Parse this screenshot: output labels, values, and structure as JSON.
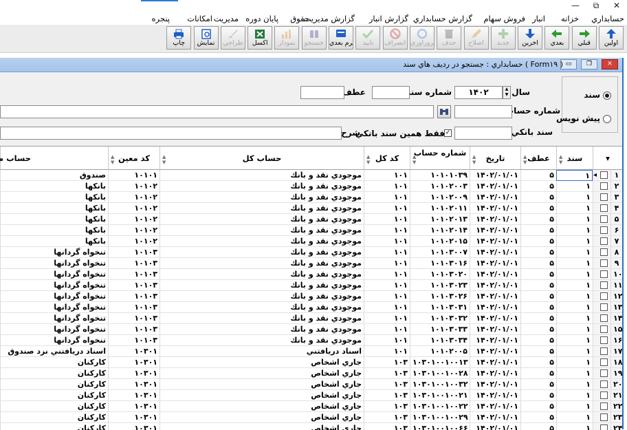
{
  "window": {
    "minimize": "—",
    "restore": "⧉",
    "close": "✕"
  },
  "menu": [
    "حسابداري",
    "خزانه",
    "انبار",
    "فروش",
    "سهام",
    "گزارش حسابداري",
    "گزارش انبار",
    "گزارش مديريت",
    "حقوق",
    "پايان دوره",
    "مديريت",
    "امكانات",
    "پنجره"
  ],
  "toolbar": [
    {
      "label": "اولين",
      "icon": "arrow-up-icon",
      "color": "#1e5fc8",
      "enabled": true
    },
    {
      "label": "قبلي",
      "icon": "arrow-right-icon",
      "color": "#2f9b2f",
      "enabled": true
    },
    {
      "label": "بعدي",
      "icon": "arrow-left-icon",
      "color": "#2f9b2f",
      "enabled": true
    },
    {
      "label": "آخرين",
      "icon": "arrow-down-icon",
      "color": "#1e5fc8",
      "enabled": true
    },
    {
      "label": "جديد",
      "icon": "plus-icon",
      "color": "#2f9b2f",
      "enabled": false
    },
    {
      "label": "اصلاح",
      "icon": "pencil-icon",
      "color": "#d08a22",
      "enabled": false
    },
    {
      "label": "حذف",
      "icon": "trash-icon",
      "color": "#555555",
      "enabled": false
    },
    {
      "label": "بروزآوري",
      "icon": "refresh-icon",
      "color": "#3a7bd5",
      "enabled": false
    },
    {
      "label": "انصراف",
      "icon": "cancel-icon",
      "color": "#c62828",
      "enabled": false
    },
    {
      "label": "تاييد",
      "icon": "check-icon",
      "color": "#2f9b2f",
      "enabled": false
    },
    {
      "label": "فرم بعدي",
      "icon": "form-icon",
      "color": "#1e5fc8",
      "enabled": true
    },
    {
      "label": "جستجو",
      "icon": "binoculars-icon",
      "color": "#3b3b8f",
      "enabled": false
    },
    {
      "label": "نمودار",
      "icon": "chart-icon",
      "color": "#e08a1e",
      "enabled": false
    },
    {
      "label": "اكسل",
      "icon": "excel-icon",
      "color": "#1f7a3a",
      "enabled": true
    },
    {
      "label": "طراحي",
      "icon": "brush-icon",
      "color": "#b04a1e",
      "enabled": false
    },
    {
      "label": "نمايش",
      "icon": "preview-icon",
      "color": "#1e5fc8",
      "enabled": true
    },
    {
      "label": "چاپ",
      "icon": "printer-icon",
      "color": "#1e5fc8",
      "enabled": true
    }
  ],
  "child_window": {
    "title": "حسابداري : جستجو در رديف هاي سند ( Form۱۹ )"
  },
  "form": {
    "radio_sanad": "سند",
    "radio_pishnevis": "پيش نويس",
    "sal_label": "سال",
    "sal_value": "۱۴۰۲",
    "shomare_sanad_label": "شماره سند",
    "shomare_sanad_value": "",
    "atf_label": "عطف",
    "atf_value": "",
    "shomare_hesab_label": "شماره حساب",
    "shomare_hesab_value": "",
    "sanad_banki_label": "سند بانكي",
    "sanad_banki_value": "",
    "faghat_label": "فقط همين سند بانكي",
    "sharh_label": "شرح",
    "sharh_value": ""
  },
  "grid": {
    "headers": {
      "sanad": "سند",
      "atf": "عطف",
      "tarikh": "تاريخ",
      "shomare_hesab": "شماره حساب",
      "kod_kol": "كد كل",
      "hesab_kol": "حساب كل",
      "kod_moein": "كد معين",
      "hesab_moein": "حساب معين"
    },
    "rows": [
      {
        "n": "۱",
        "sanad": "۱",
        "atf": "۵",
        "tarikh": "۱۴۰۲/۰۱/۰۱",
        "hesab": "۱۰۱۰۱۰۳۹",
        "kol": "۱۰۱",
        "kolname": "موجودي نقد و بانك",
        "moein": "۱۰۱۰۱",
        "moeinname": "صندوق"
      },
      {
        "n": "۲",
        "sanad": "۱",
        "atf": "۵",
        "tarikh": "۱۴۰۲/۰۱/۰۱",
        "hesab": "۱۰۱۰۲۰۰۳",
        "kol": "۱۰۱",
        "kolname": "موجودي نقد و بانك",
        "moein": "۱۰۱۰۲",
        "moeinname": "بانكها"
      },
      {
        "n": "۳",
        "sanad": "۱",
        "atf": "۵",
        "tarikh": "۱۴۰۲/۰۱/۰۱",
        "hesab": "۱۰۱۰۲۰۰۹",
        "kol": "۱۰۱",
        "kolname": "موجودي نقد و بانك",
        "moein": "۱۰۱۰۲",
        "moeinname": "بانكها"
      },
      {
        "n": "۴",
        "sanad": "۱",
        "atf": "۵",
        "tarikh": "۱۴۰۲/۰۱/۰۱",
        "hesab": "۱۰۱۰۲۰۱۱",
        "kol": "۱۰۱",
        "kolname": "موجودي نقد و بانك",
        "moein": "۱۰۱۰۲",
        "moeinname": "بانكها"
      },
      {
        "n": "۵",
        "sanad": "۱",
        "atf": "۵",
        "tarikh": "۱۴۰۲/۰۱/۰۱",
        "hesab": "۱۰۱۰۲۰۱۳",
        "kol": "۱۰۱",
        "kolname": "موجودي نقد و بانك",
        "moein": "۱۰۱۰۲",
        "moeinname": "بانكها"
      },
      {
        "n": "۶",
        "sanad": "۱",
        "atf": "۵",
        "tarikh": "۱۴۰۲/۰۱/۰۱",
        "hesab": "۱۰۱۰۲۰۱۴",
        "kol": "۱۰۱",
        "kolname": "موجودي نقد و بانك",
        "moein": "۱۰۱۰۲",
        "moeinname": "بانكها"
      },
      {
        "n": "۷",
        "sanad": "۱",
        "atf": "۵",
        "tarikh": "۱۴۰۲/۰۱/۰۱",
        "hesab": "۱۰۱۰۲۰۱۵",
        "kol": "۱۰۱",
        "kolname": "موجودي نقد و بانك",
        "moein": "۱۰۱۰۲",
        "moeinname": "بانكها"
      },
      {
        "n": "۸",
        "sanad": "۱",
        "atf": "۵",
        "tarikh": "۱۴۰۲/۰۱/۰۱",
        "hesab": "۱۰۱۰۳۰۰۷",
        "kol": "۱۰۱",
        "kolname": "موجودي نقد و بانك",
        "moein": "۱۰۱۰۳",
        "moeinname": "تنخواه گردانها"
      },
      {
        "n": "۹",
        "sanad": "۱",
        "atf": "۵",
        "tarikh": "۱۴۰۲/۰۱/۰۱",
        "hesab": "۱۰۱۰۳۰۱۶",
        "kol": "۱۰۱",
        "kolname": "موجودي نقد و بانك",
        "moein": "۱۰۱۰۳",
        "moeinname": "تنخواه گردانها"
      },
      {
        "n": "۱۰",
        "sanad": "۱",
        "atf": "۵",
        "tarikh": "۱۴۰۲/۰۱/۰۱",
        "hesab": "۱۰۱۰۳۰۲۰",
        "kol": "۱۰۱",
        "kolname": "موجودي نقد و بانك",
        "moein": "۱۰۱۰۳",
        "moeinname": "تنخواه گردانها"
      },
      {
        "n": "۱۱",
        "sanad": "۱",
        "atf": "۵",
        "tarikh": "۱۴۰۲/۰۱/۰۱",
        "hesab": "۱۰۱۰۳۰۲۳",
        "kol": "۱۰۱",
        "kolname": "موجودي نقد و بانك",
        "moein": "۱۰۱۰۳",
        "moeinname": "تنخواه گردانها"
      },
      {
        "n": "۱۲",
        "sanad": "۱",
        "atf": "۵",
        "tarikh": "۱۴۰۲/۰۱/۰۱",
        "hesab": "۱۰۱۰۳۰۲۶",
        "kol": "۱۰۱",
        "kolname": "موجودي نقد و بانك",
        "moein": "۱۰۱۰۳",
        "moeinname": "تنخواه گردانها"
      },
      {
        "n": "۱۳",
        "sanad": "۱",
        "atf": "۵",
        "tarikh": "۱۴۰۲/۰۱/۰۱",
        "hesab": "۱۰۱۰۳۰۳۱",
        "kol": "۱۰۱",
        "kolname": "موجودي نقد و بانك",
        "moein": "۱۰۱۰۳",
        "moeinname": "تنخواه گردانها"
      },
      {
        "n": "۱۴",
        "sanad": "۱",
        "atf": "۵",
        "tarikh": "۱۴۰۲/۰۱/۰۱",
        "hesab": "۱۰۱۰۳۰۳۲",
        "kol": "۱۰۱",
        "kolname": "موجودي نقد و بانك",
        "moein": "۱۰۱۰۳",
        "moeinname": "تنخواه گردانها"
      },
      {
        "n": "۱۵",
        "sanad": "۱",
        "atf": "۵",
        "tarikh": "۱۴۰۲/۰۱/۰۱",
        "hesab": "۱۰۱۰۳۰۳۳",
        "kol": "۱۰۱",
        "kolname": "موجودي نقد و بانك",
        "moein": "۱۰۱۰۳",
        "moeinname": "تنخواه گردانها"
      },
      {
        "n": "۱۶",
        "sanad": "۱",
        "atf": "۵",
        "tarikh": "۱۴۰۲/۰۱/۰۱",
        "hesab": "۱۰۱۰۳۰۳۴",
        "kol": "۱۰۱",
        "kolname": "موجودي نقد و بانك",
        "moein": "۱۰۱۰۳",
        "moeinname": "تنخواه گردانها"
      },
      {
        "n": "۱۷",
        "sanad": "۱",
        "atf": "۵",
        "tarikh": "۱۴۰۲/۰۱/۰۱",
        "hesab": "۱۰۱۰۲۰۰۵",
        "kol": "۱۰۱",
        "kolname": "اسناد دريافتني",
        "moein": "۱۰۳۰۱",
        "moeinname": "اسناد دريافتني نزد صندوق"
      },
      {
        "n": "۱۸",
        "sanad": "۱",
        "atf": "۵",
        "tarikh": "۱۴۰۲/۰۱/۰۱",
        "hesab": "۱۰۳۰۱۰۰۱۰۰۱۳",
        "kol": "۱۰۳",
        "kolname": "جاري اشخاص",
        "moein": "۱۰۳۰۱",
        "moeinname": "كاركنان"
      },
      {
        "n": "۱۹",
        "sanad": "۱",
        "atf": "۵",
        "tarikh": "۱۴۰۲/۰۱/۰۱",
        "hesab": "۱۰۳۰۱۰۰۱۰۰۲۸",
        "kol": "۱۰۳",
        "kolname": "جاري اشخاص",
        "moein": "۱۰۳۰۱",
        "moeinname": "كاركنان"
      },
      {
        "n": "۲۰",
        "sanad": "۱",
        "atf": "۵",
        "tarikh": "۱۴۰۲/۰۱/۰۱",
        "hesab": "۱۰۳۰۱۰۰۱۰۰۳۲",
        "kol": "۱۰۳",
        "kolname": "جاري اشخاص",
        "moein": "۱۰۳۰۱",
        "moeinname": "كاركنان"
      },
      {
        "n": "۲۱",
        "sanad": "۱",
        "atf": "۵",
        "tarikh": "۱۴۰۲/۰۱/۰۱",
        "hesab": "۱۰۳۰۱۰۰۱۰۰۲۱",
        "kol": "۱۰۳",
        "kolname": "جاري اشخاص",
        "moein": "۱۰۳۰۱",
        "moeinname": "كاركنان"
      },
      {
        "n": "۲۲",
        "sanad": "۱",
        "atf": "۵",
        "tarikh": "۱۴۰۲/۰۱/۰۱",
        "hesab": "۱۰۳۰۱۰۰۱۰۰۲۲",
        "kol": "۱۰۳",
        "kolname": "جاري اشخاص",
        "moein": "۱۰۳۰۱",
        "moeinname": "كاركنان"
      },
      {
        "n": "۲۳",
        "sanad": "۱",
        "atf": "۵",
        "tarikh": "۱۴۰۲/۰۱/۰۱",
        "hesab": "۱۰۳۰۱۰۰۱۰۰۲۹",
        "kol": "۱۰۳",
        "kolname": "جاري اشخاص",
        "moein": "۱۰۳۰۱",
        "moeinname": "كاركنان"
      },
      {
        "n": "۲۴",
        "sanad": "۱",
        "atf": "۵",
        "tarikh": "۱۴۰۲/۰۱/۰۱",
        "hesab": "۱۰۳۰۱۰۰۱۰۰۶۶",
        "kol": "۱۰۳",
        "kolname": "جاري اشخاص",
        "moein": "۱۰۳۰۱",
        "moeinname": "كاركنان"
      }
    ]
  }
}
